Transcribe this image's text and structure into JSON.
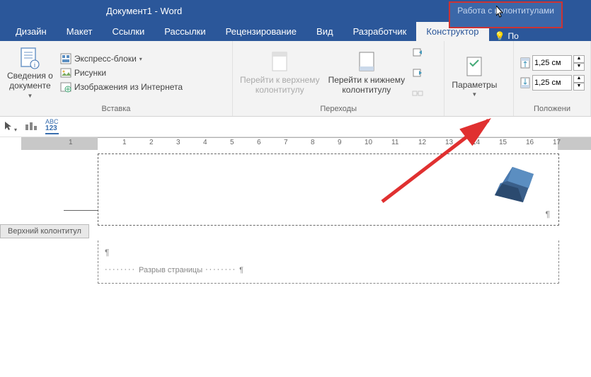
{
  "title": "Документ1 - Word",
  "context_tab": "Работа с колонтитулами",
  "tabs": [
    "Дизайн",
    "Макет",
    "Ссылки",
    "Рассылки",
    "Рецензирование",
    "Вид",
    "Разработчик",
    "Конструктор"
  ],
  "tell_me": "По",
  "ribbon": {
    "info": {
      "doc_info": "Сведения о\nдокументе",
      "express": "Экспресс-блоки",
      "pictures": "Рисунки",
      "online_pics": "Изображения из Интернета",
      "group": "Вставка"
    },
    "nav": {
      "goto_header": "Перейти к верхнему\nколонтитулу",
      "goto_footer": "Перейти к нижнему\nколонтитулу",
      "group": "Переходы"
    },
    "options": {
      "label": "Параметры"
    },
    "position": {
      "top": "1,25 см",
      "bottom": "1,25 см",
      "group": "Положени"
    }
  },
  "header_tag": "Верхний колонтитул",
  "page_break": "Разрыв страницы",
  "ruler_nums": [
    "1",
    "1",
    "2",
    "3",
    "4",
    "5",
    "6",
    "7",
    "8",
    "9",
    "10",
    "11",
    "12",
    "13",
    "14",
    "15",
    "16",
    "17"
  ]
}
